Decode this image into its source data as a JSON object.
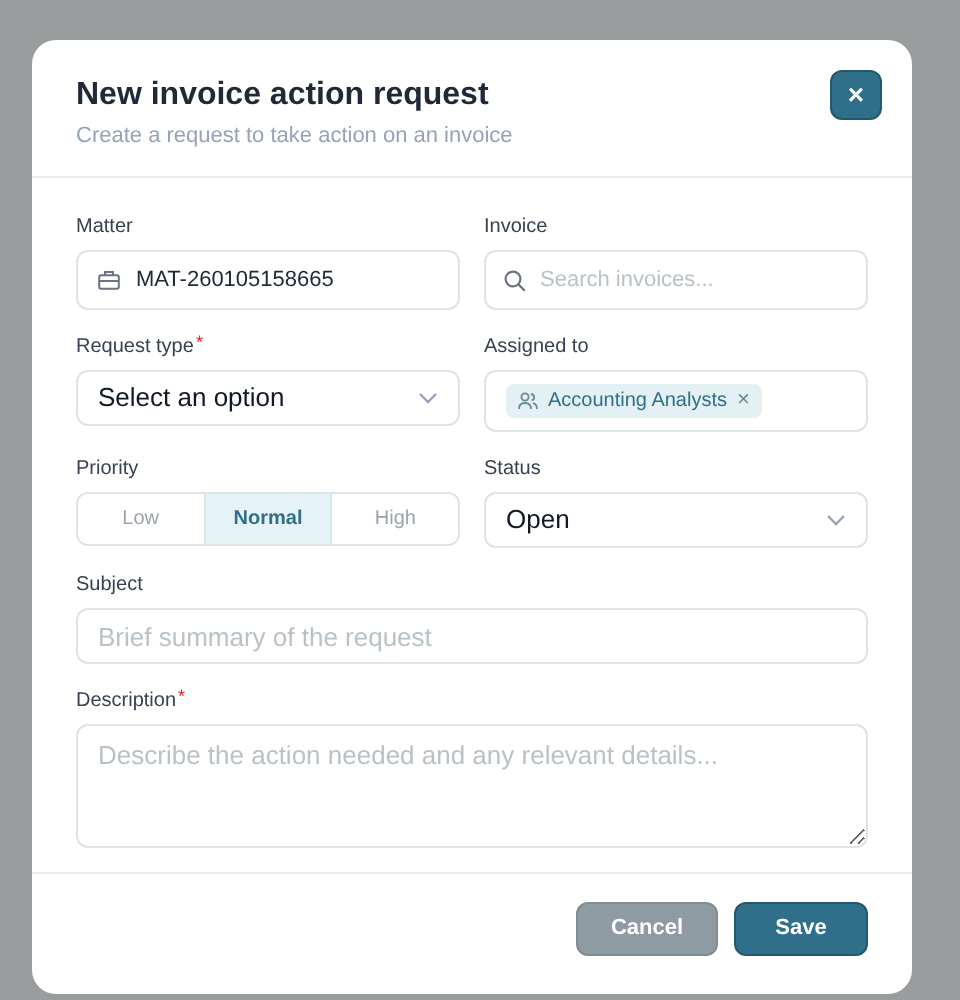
{
  "dialog": {
    "title": "New invoice action request",
    "subtitle": "Create a request to take action on an invoice",
    "close_icon": "×"
  },
  "fields": [
    {
      "kind": "text",
      "label": "Matter",
      "value": "MAT-260105158665"
    },
    {
      "kind": "search",
      "label": "Invoice",
      "placeholder": "Search invoices..."
    },
    {
      "kind": "select",
      "label": "Request type",
      "required_mark": "*",
      "value": "Select an option"
    },
    {
      "kind": "chips",
      "label": "Assigned to",
      "chips": [
        {
          "label": "Accounting Analysts",
          "remove": "×"
        }
      ]
    },
    {
      "kind": "segmented",
      "label": "Priority",
      "options": [
        {
          "label": "Low",
          "selected": false
        },
        {
          "label": "Normal",
          "selected": true
        },
        {
          "label": "High",
          "selected": false
        }
      ]
    },
    {
      "kind": "select",
      "label": "Status",
      "value": "Open"
    },
    {
      "kind": "wide",
      "label": "Subject",
      "placeholder": "Brief summary of the request"
    },
    {
      "kind": "textarea",
      "label": "Description",
      "required_mark": "*",
      "placeholder": "Describe the action needed and any relevant details..."
    }
  ],
  "buttons": [
    {
      "label": "Cancel",
      "kind": "secondary"
    },
    {
      "label": "Save",
      "kind": "primary"
    }
  ]
}
